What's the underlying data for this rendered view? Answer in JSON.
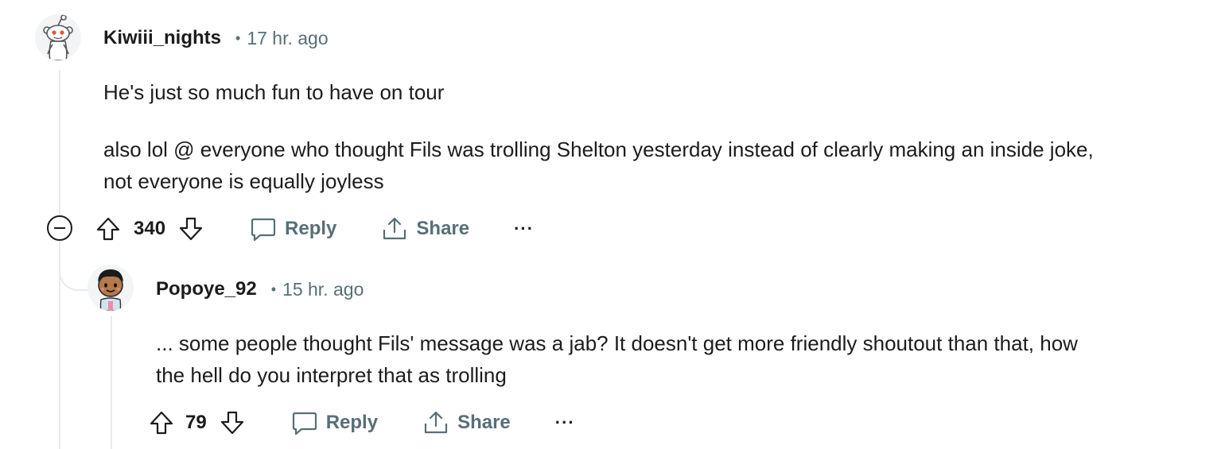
{
  "comments": [
    {
      "username": "Kiwiii_nights",
      "separator": "•",
      "time": "17 hr. ago",
      "paragraphs": [
        "He's just so much fun to have on tour",
        "also lol @ everyone who thought Fils was trolling Shelton yesterday instead of clearly making an inside joke,",
        "not everyone is equally joyless"
      ],
      "score": "340",
      "reply_label": "Reply",
      "share_label": "Share",
      "more_label": "···",
      "avatar_icon": "snoo-avatar-icon"
    },
    {
      "username": "Popoye_92",
      "separator": "•",
      "time": "15 hr. ago",
      "paragraphs": [
        "... some people thought Fils' message was a jab? It doesn't get more friendly shoutout than that, how",
        "the hell do you interpret that as trolling"
      ],
      "score": "79",
      "reply_label": "Reply",
      "share_label": "Share",
      "more_label": "···",
      "avatar_icon": "cartoon-avatar-icon"
    }
  ],
  "colors": {
    "meta_gray": "#576f76",
    "text": "#1c1c1c",
    "thread_line": "#e5ebee"
  }
}
